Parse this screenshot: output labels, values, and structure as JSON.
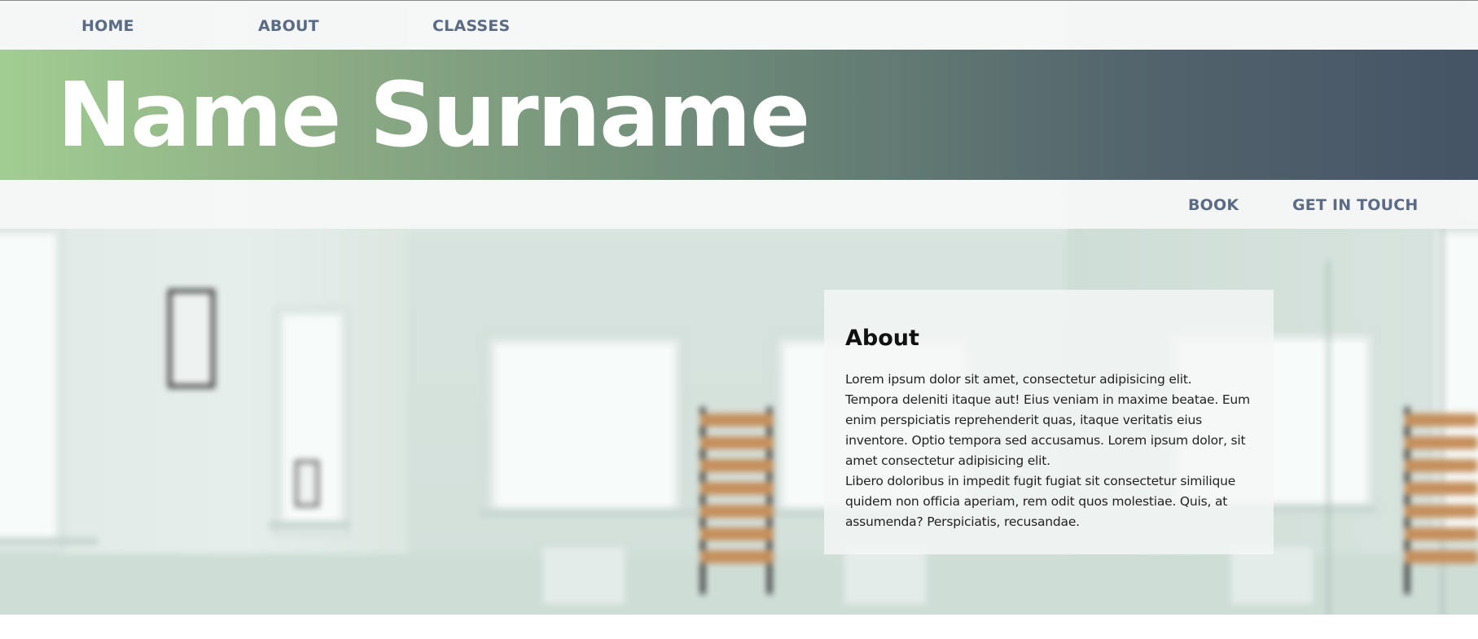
{
  "nav": {
    "top_links": [
      {
        "label": "HOME"
      },
      {
        "label": "ABOUT"
      },
      {
        "label": "CLASSES"
      }
    ],
    "secondary_links": [
      {
        "label": "BOOK"
      },
      {
        "label": "GET IN TOUCH"
      }
    ],
    "link_color": "#5b6b86"
  },
  "header": {
    "title": "Name Surname",
    "gradient_start": "#a2cd92",
    "gradient_end": "#455466"
  },
  "about": {
    "heading": "About",
    "paragraph1": "Lorem ipsum dolor sit amet, consectetur adipisicing elit.\nTempora deleniti itaque aut! Eius veniam in maxime beatae. Eum\nenim perspiciatis reprehenderit quas, itaque veritatis eius\ninventore. Optio tempora sed accusamus. Lorem ipsum dolor, sit\namet consectetur adipisicing elit.",
    "paragraph2": "Libero doloribus in impedit fugit fugiat sit consectetur similique\nquidem non officia aperiam, rem odit quos molestiae. Quis, at\nassumenda? Perspiciatis, recusandae."
  },
  "background": {
    "image_subject": "blurred-studio-room-photo"
  }
}
